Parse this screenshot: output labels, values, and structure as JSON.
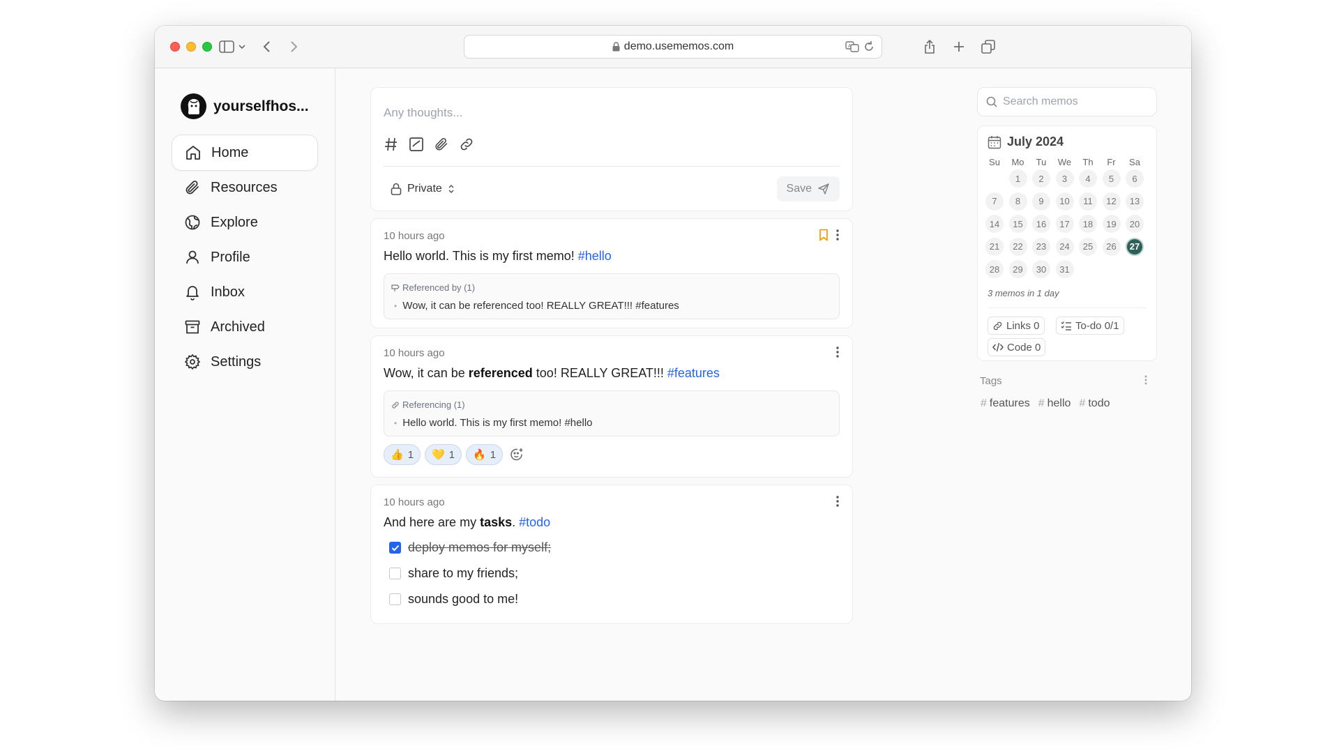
{
  "browser": {
    "url": "demo.usememos.com"
  },
  "brand": {
    "name": "yourselfhos..."
  },
  "nav": {
    "items": [
      {
        "label": "Home",
        "icon": "home-icon",
        "active": true
      },
      {
        "label": "Resources",
        "icon": "paperclip-icon",
        "active": false
      },
      {
        "label": "Explore",
        "icon": "globe-icon",
        "active": false
      },
      {
        "label": "Profile",
        "icon": "user-icon",
        "active": false
      },
      {
        "label": "Inbox",
        "icon": "bell-icon",
        "active": false
      },
      {
        "label": "Archived",
        "icon": "archive-icon",
        "active": false
      },
      {
        "label": "Settings",
        "icon": "gear-icon",
        "active": false
      }
    ]
  },
  "editor": {
    "placeholder": "Any thoughts...",
    "visibility": "Private",
    "save_label": "Save"
  },
  "memos": [
    {
      "time": "10 hours ago",
      "text": "Hello world. This is my first memo!",
      "tag": "#hello",
      "reference": {
        "title": "Referenced by (1)",
        "item": "Wow, it can be referenced too! REALLY GREAT!!! #features"
      }
    },
    {
      "time": "10 hours ago",
      "text_before": "Wow, it can be ",
      "text_bold": "referenced",
      "text_after": " too! REALLY GREAT!!! ",
      "tag": "#features",
      "reference": {
        "title": "Referencing (1)",
        "item": "Hello world. This is my first memo! #hello"
      },
      "reactions": [
        {
          "emoji": "👍",
          "count": "1"
        },
        {
          "emoji": "💛",
          "count": "1"
        },
        {
          "emoji": "🔥",
          "count": "1"
        }
      ]
    },
    {
      "time": "10 hours ago",
      "text_before": "And here are my ",
      "text_bold": "tasks",
      "text_after": ". ",
      "tag": "#todo",
      "tasks": [
        {
          "label": "deploy memos for myself;",
          "done": true
        },
        {
          "label": "share to my friends;",
          "done": false
        },
        {
          "label": "sounds good to me!",
          "done": false
        }
      ]
    }
  ],
  "search": {
    "placeholder": "Search memos"
  },
  "calendar": {
    "month": "July 2024",
    "weekdays": [
      "Su",
      "Mo",
      "Tu",
      "We",
      "Th",
      "Fr",
      "Sa"
    ],
    "first_weekday_index": 1,
    "days_in_month": 31,
    "today": 27,
    "summary": "3 memos in 1 day"
  },
  "stats": {
    "links": "Links 0",
    "todo": "To-do 0/1",
    "code": "Code 0"
  },
  "tags": {
    "title": "Tags",
    "items": [
      "features",
      "hello",
      "todo"
    ]
  },
  "colors": {
    "accent": "#2563eb",
    "today": "#2f5f5a",
    "bookmark": "#f59e0b"
  }
}
